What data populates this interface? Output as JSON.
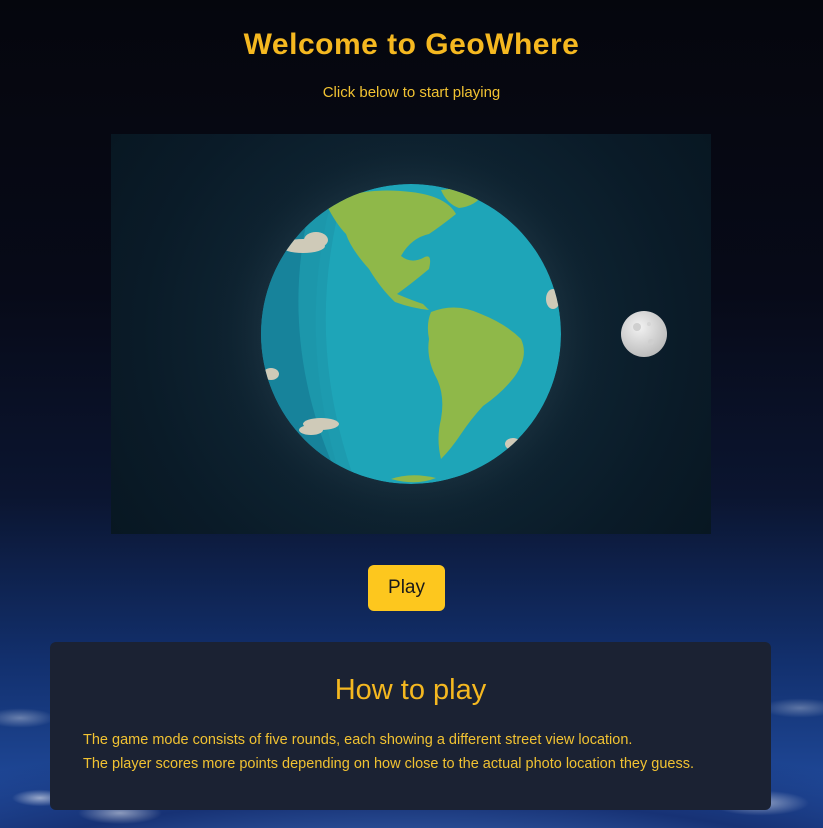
{
  "header": {
    "title": "Welcome to GeoWhere",
    "subtitle": "Click below to start playing"
  },
  "hero": {
    "illustration": "earth-and-moon-illustration"
  },
  "actions": {
    "play_label": "Play"
  },
  "how_to_play": {
    "title": "How to play",
    "lines": [
      "The game mode consists of five rounds, each showing a different street view location.",
      "The player scores more points depending on how close to the actual photo location they guess."
    ]
  },
  "colors": {
    "accent": "#f5b820",
    "button": "#fdc71e",
    "panel": "#1b2233",
    "ocean": "#1a9fb3",
    "land": "#8fb849"
  }
}
